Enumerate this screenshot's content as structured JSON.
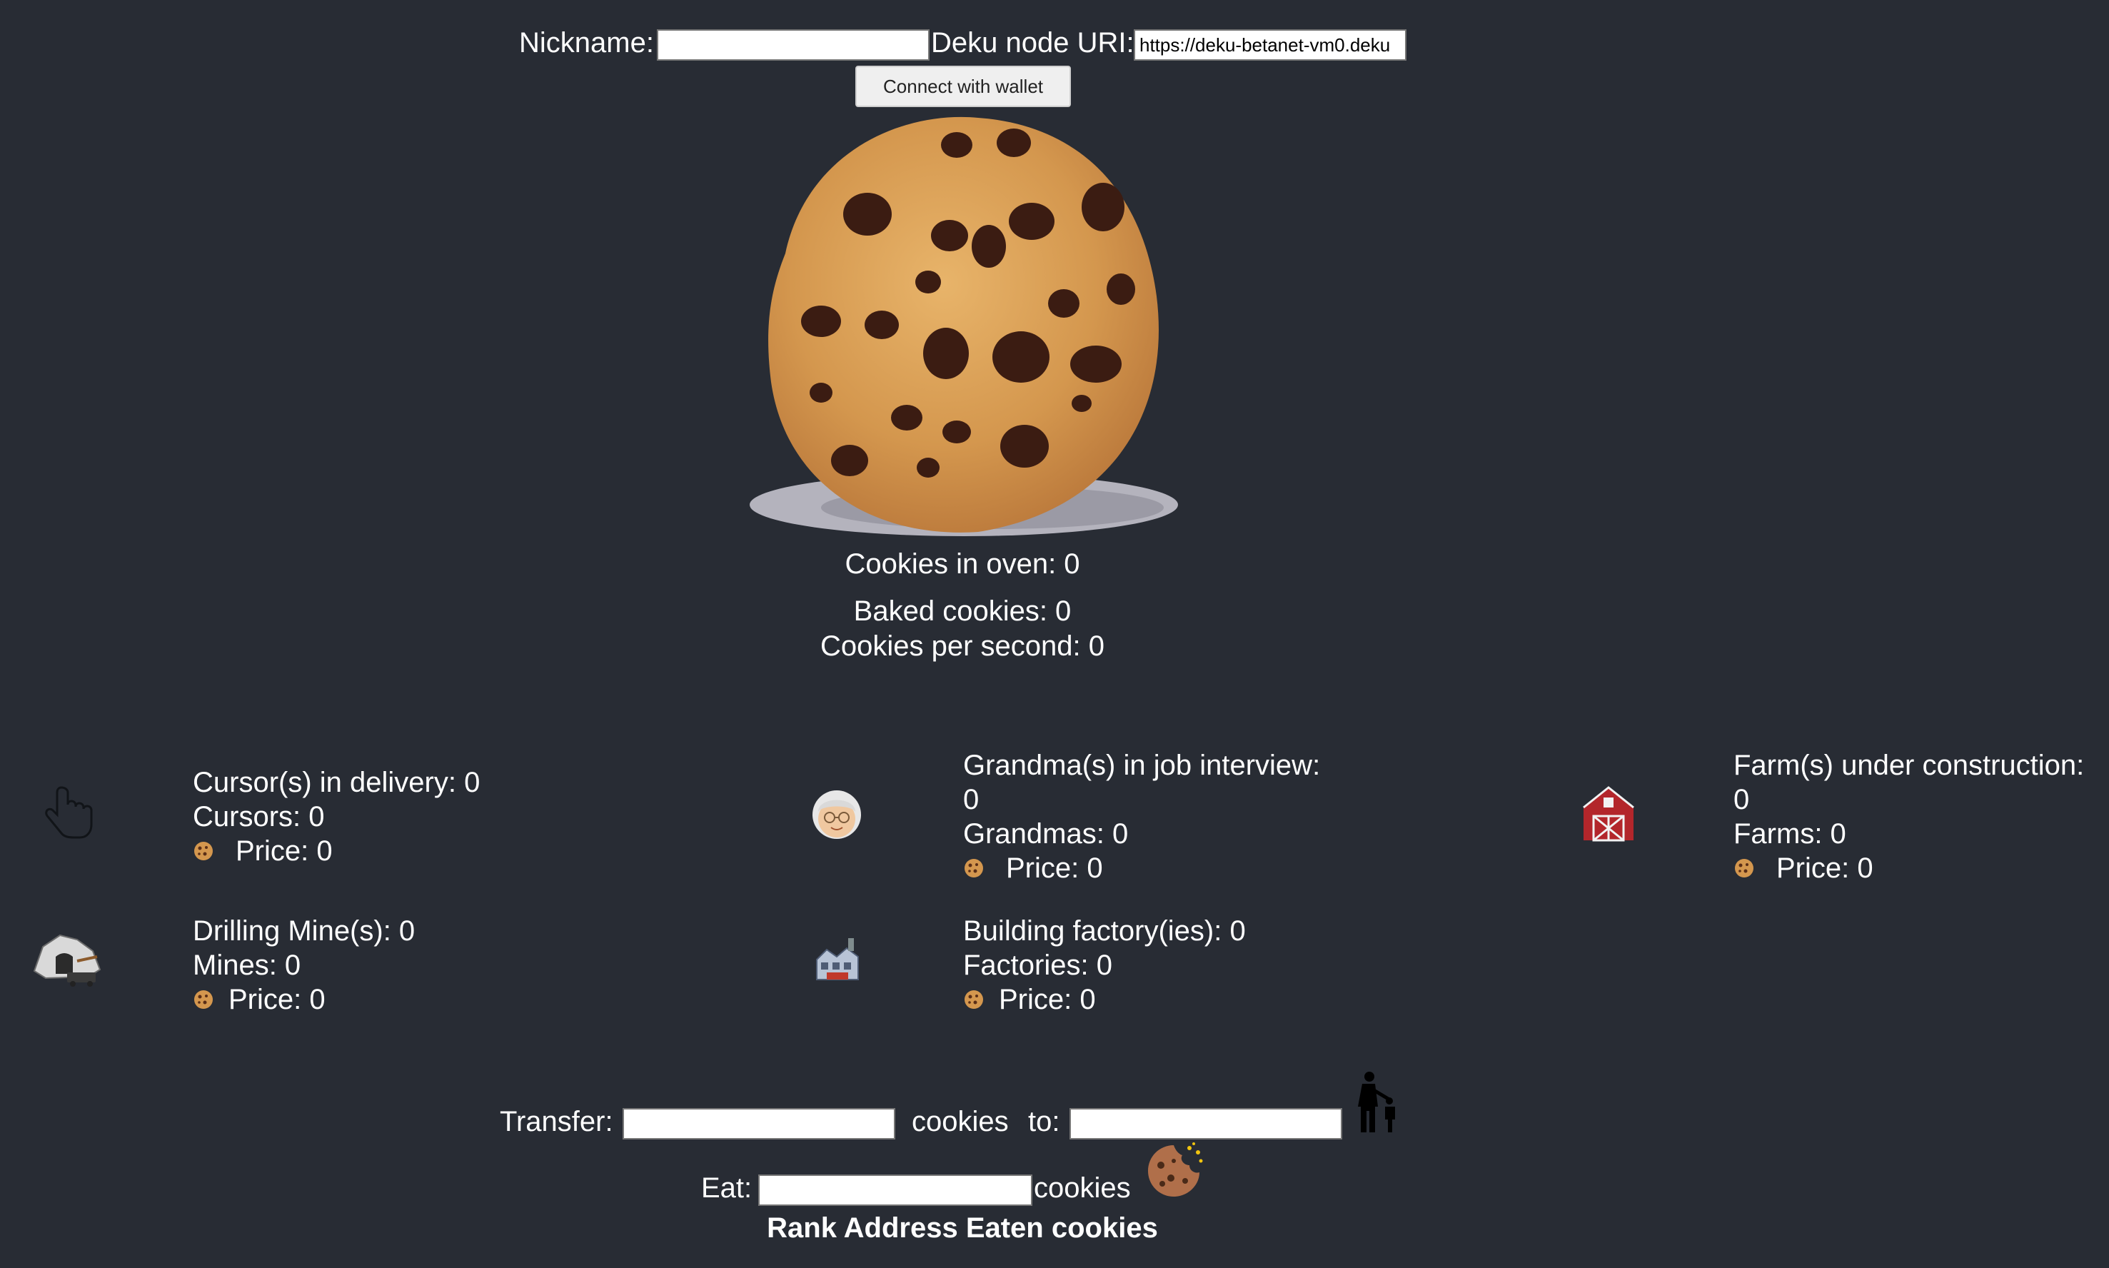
{
  "header": {
    "nickname_label": "Nickname:",
    "nickname_value": "",
    "uri_label": "Deku node URI:",
    "uri_value": "https://deku-betanet-vm0.deku",
    "connect_label": "Connect with wallet"
  },
  "stats": {
    "oven": "Cookies in oven: 0",
    "baked": "Baked cookies: 0",
    "per_second": "Cookies per second: 0"
  },
  "buildings": {
    "cursor": {
      "pending": "Cursor(s) in delivery: 0",
      "count": "Cursors: 0",
      "price": "Price: 0",
      "icon": "pointing-hand-icon"
    },
    "grandma": {
      "pending_a": "Grandma(s) in job interview:",
      "pending_b": "0",
      "count": "Grandmas: 0",
      "price": "Price: 0",
      "icon": "grandma-icon"
    },
    "farm": {
      "pending_a": "Farm(s) under construction:",
      "pending_b": "0",
      "count": "Farms: 0",
      "price": "Price: 0",
      "icon": "barn-icon"
    },
    "mine": {
      "pending": "Drilling Mine(s): 0",
      "count": "Mines: 0",
      "price": "Price: 0",
      "icon": "mine-icon"
    },
    "factory": {
      "pending": "Building factory(ies): 0",
      "count": "Factories: 0",
      "price": "Price: 0",
      "icon": "factory-icon"
    }
  },
  "transfer": {
    "label": "Transfer:",
    "amount_value": "",
    "cookies_label": "cookies",
    "to_label": "to:",
    "recipient_value": "",
    "icon": "person-giving-icon"
  },
  "eat": {
    "label": "Eat:",
    "amount_value": "",
    "cookies_label": "cookies",
    "icon": "bitten-cookie-icon"
  },
  "leaderboard": {
    "headers": [
      "Rank",
      "Address",
      "Eaten cookies"
    ]
  },
  "colors": {
    "background": "#282c34",
    "text": "#ffffff",
    "barn": "#b3262b",
    "cookie": "#d4974e"
  }
}
